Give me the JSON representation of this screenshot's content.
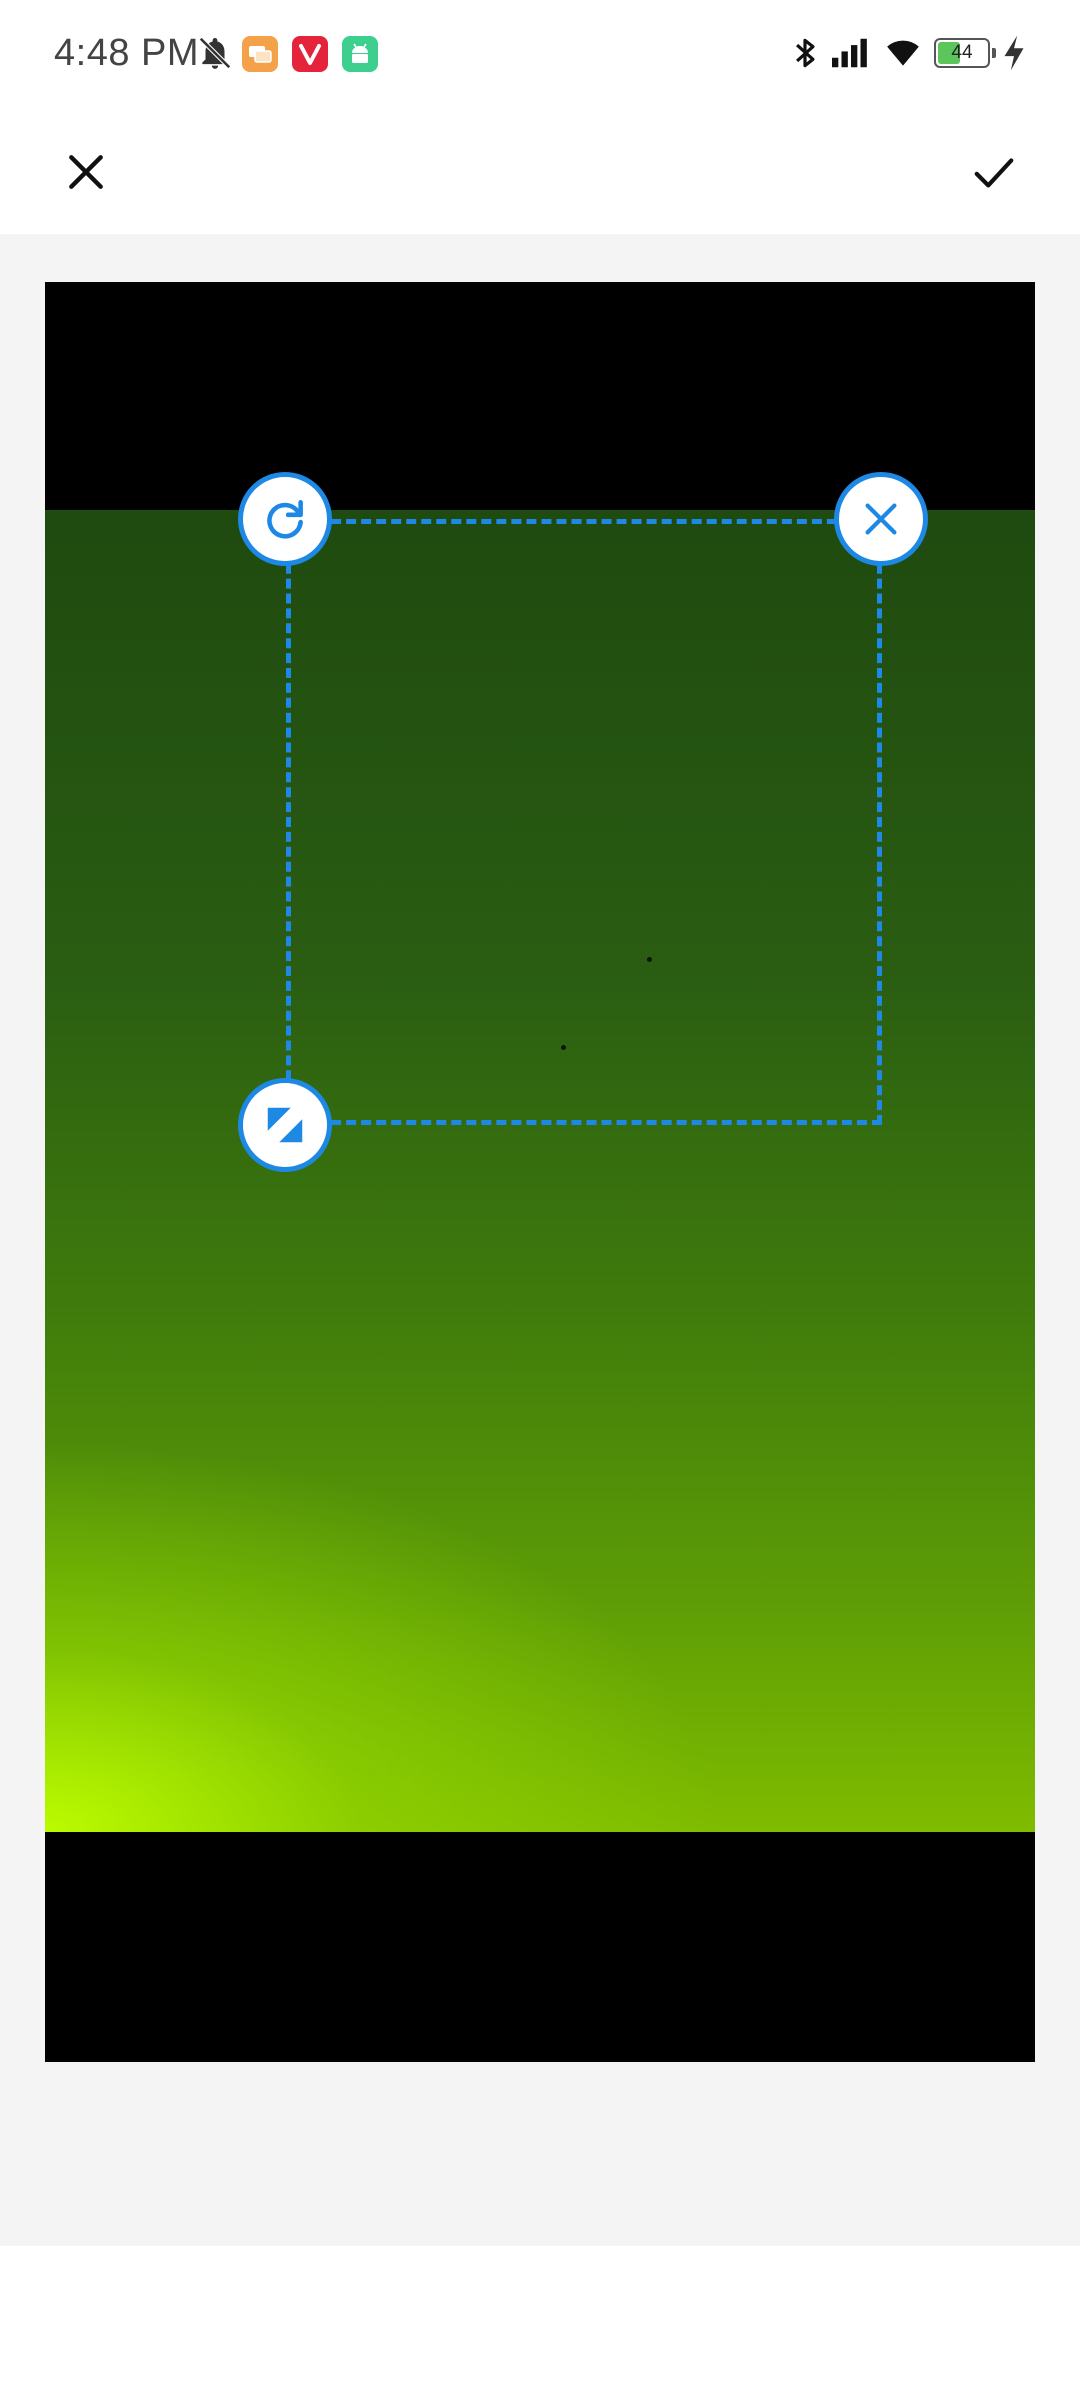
{
  "status_bar": {
    "time": "4:48 PM",
    "battery_level": "44",
    "icons": [
      "bell-off-icon",
      "chat-app-icon",
      "vivaldi-app-icon",
      "android-app-icon",
      "bluetooth-icon",
      "signal-icon",
      "wifi-icon",
      "battery-icon",
      "charging-icon"
    ]
  },
  "app_bar": {
    "close_icon": "close-icon",
    "confirm_icon": "check-icon"
  },
  "crop": {
    "rotate_handle_icon": "rotate-icon",
    "remove_handle_icon": "close-icon",
    "resize_handle_icon": "resize-icon"
  },
  "colors": {
    "accent": "#1e88e5",
    "background": "#f4f4f4"
  }
}
